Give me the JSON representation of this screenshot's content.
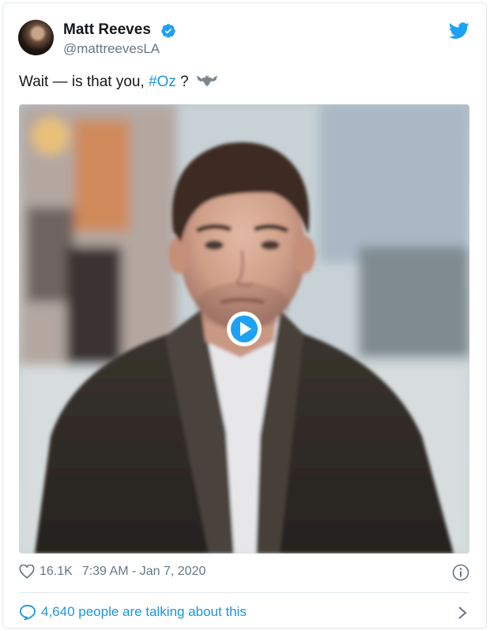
{
  "author": {
    "name": "Matt Reeves",
    "handle": "@mattreevesLA"
  },
  "tweet": {
    "text_before": "Wait — is that you, ",
    "hashtag": "#Oz",
    "text_after": " ?"
  },
  "media": {
    "type": "video",
    "play_icon": "play-icon"
  },
  "footer": {
    "like_count": "16.1K",
    "timestamp": "7:39 AM - Jan 7, 2020",
    "talking": "4,640 people are talking about this"
  },
  "colors": {
    "link_blue": "#1b95e0",
    "muted_gray": "#657786",
    "verified_blue": "#1da1f2"
  },
  "icons": [
    "avatar",
    "verified-icon",
    "twitter-bird-icon",
    "bat-emoji-icon",
    "play-icon",
    "heart-icon",
    "info-icon",
    "speech-bubble-icon",
    "chevron-right-icon"
  ]
}
